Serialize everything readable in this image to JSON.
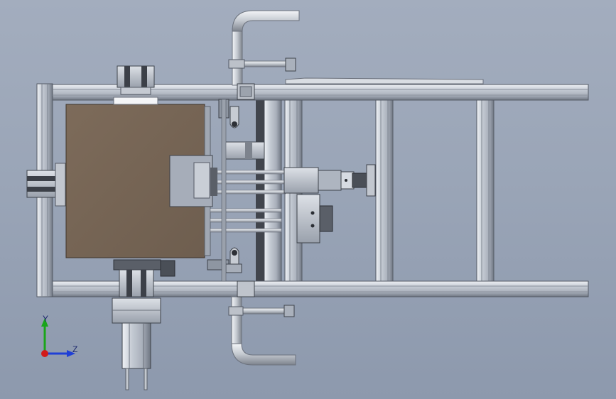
{
  "viewport": {
    "background_top": "#a3adbe",
    "background_bottom": "#8d99ad"
  },
  "model": {
    "frame_color": "#b9c0cb",
    "plate_color": "#766555",
    "pipe_color": "#c3c8cf",
    "dark_part_color": "#3c4048"
  },
  "triad": {
    "y_label": "Y",
    "z_label": "Z",
    "y_axis_color": "#1aa51a",
    "z_axis_color": "#1f3fd6",
    "origin_color": "#d21a1a"
  }
}
